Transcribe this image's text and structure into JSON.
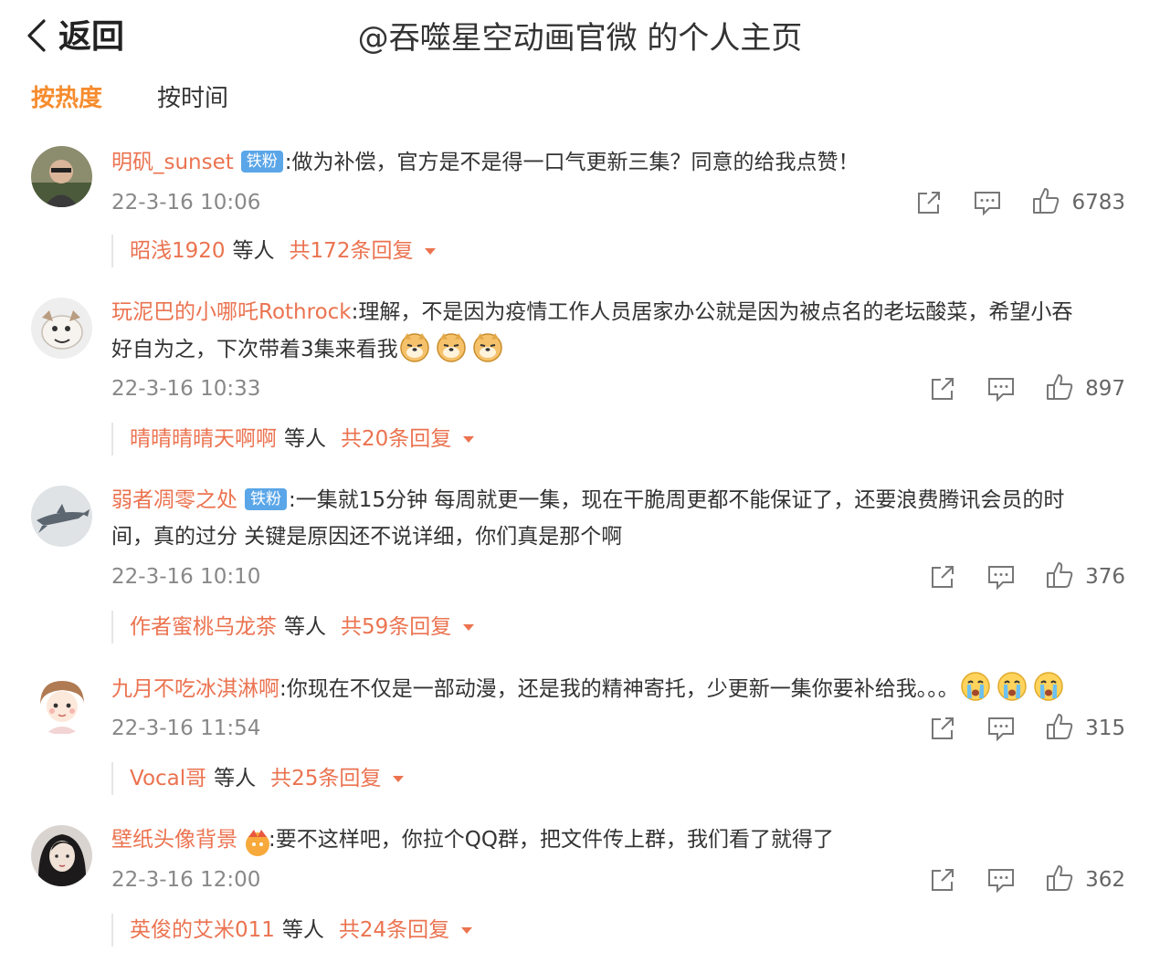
{
  "header": {
    "back_label": "返回",
    "title": "@吞噬星空动画官微 的个人主页"
  },
  "tabs": [
    {
      "label": "按热度",
      "active": true
    },
    {
      "label": "按时间",
      "active": false
    }
  ],
  "colors": {
    "accent": "#f68c2e",
    "username": "#eb7350",
    "badge": "#5aa6e8",
    "meta": "#888888"
  },
  "comments": [
    {
      "username": "明矾_sunset",
      "badge": "铁粉",
      "text_line1": ":做为补偿，官方是不是得一口气更新三集？同意的给我点赞！",
      "text_line2": "",
      "time": "22-3-16 10:06",
      "likes": "6783",
      "reply_user": "昭浅1920",
      "reply_etc": "等人",
      "reply_total": "共172条回复"
    },
    {
      "username": "玩泥巴的小哪吒Rothrock",
      "badge": "",
      "text_line1": ":理解，不是因为疫情工作人员居家办公就是因为被点名的老坛酸菜，希望小吞",
      "text_line2": "好自为之，下次带着3集来看我",
      "time": "22-3-16 10:33",
      "likes": "897",
      "reply_user": "晴晴晴晴天啊啊",
      "reply_etc": "等人",
      "reply_total": "共20条回复"
    },
    {
      "username": "弱者凋零之处",
      "badge": "铁粉",
      "text_line1": ":一集就15分钟 每周就更一集，现在干脆周更都不能保证了，还要浪费腾讯会员的时",
      "text_line2": "间，真的过分 关键是原因还不说详细，你们真是那个啊",
      "time": "22-3-16 10:10",
      "likes": "376",
      "reply_user": "作者蜜桃乌龙茶",
      "reply_etc": "等人",
      "reply_total": "共59条回复"
    },
    {
      "username": "九月不吃冰淇淋啊",
      "badge": "",
      "text_line1": ":你现在不仅是一部动漫，还是我的精神寄托，少更新一集你要补给我。。。",
      "text_line2": "",
      "time": "22-3-16 11:54",
      "likes": "315",
      "reply_user": "Vocal哥",
      "reply_etc": "等人",
      "reply_total": "共25条回复"
    },
    {
      "username": "壁纸头像背景",
      "badge": "",
      "text_line1": ":要不这样吧，你拉个QQ群，把文件传上群，我们看了就得了",
      "text_line2": "",
      "time": "22-3-16 12:00",
      "likes": "362",
      "reply_user": "英俊的艾米011",
      "reply_etc": "等人",
      "reply_total": "共24条回复"
    }
  ],
  "icons": {
    "back": "chevron-left-icon",
    "repost": "share-icon",
    "comment": "comment-icon",
    "like": "thumbs-up-icon",
    "dog_emoji": "doge-emoji-icon",
    "cry_emoji": "crying-emoji-icon",
    "expand": "caret-down-icon"
  }
}
